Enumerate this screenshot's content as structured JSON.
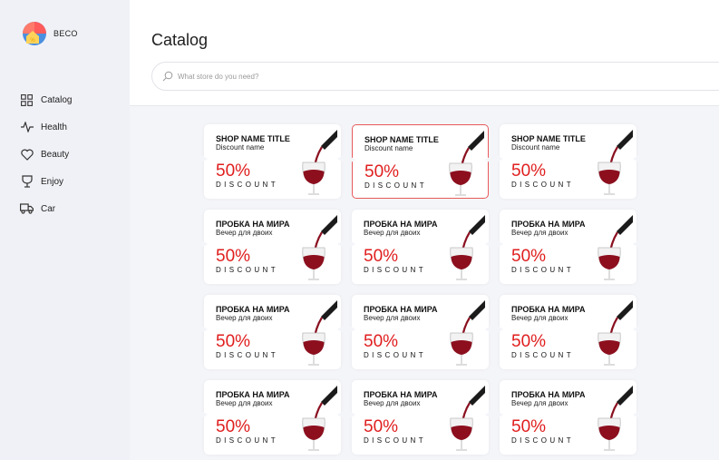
{
  "brand": {
    "name": "BECO"
  },
  "sidebar": {
    "items": [
      {
        "label": "Catalog",
        "icon": "grid-icon"
      },
      {
        "label": "Health",
        "icon": "pulse-icon"
      },
      {
        "label": "Beauty",
        "icon": "heart-icon"
      },
      {
        "label": "Enjoy",
        "icon": "goblet-icon"
      },
      {
        "label": "Car",
        "icon": "truck-icon"
      }
    ]
  },
  "header": {
    "title": "Catalog",
    "search_placeholder": "What store do you need?"
  },
  "colors": {
    "accent": "#e01e1e",
    "selected_border": "#e85a5a"
  },
  "cards": [
    {
      "shop": "SHOP NAME TITLE",
      "subtitle": "Discount name",
      "percent": "50%",
      "label": "DISCOUNT",
      "image": "wine-pour-image"
    },
    {
      "shop": "SHOP NAME TITLE",
      "subtitle": "Discount name",
      "percent": "50%",
      "label": "DISCOUNT",
      "image": "wine-pour-image"
    },
    {
      "shop": "SHOP NAME TITLE",
      "subtitle": "Discount name",
      "percent": "50%",
      "label": "DISCOUNT",
      "image": "wine-pour-image"
    },
    {
      "shop": "ПРОБКА НА МИРА",
      "subtitle": "Вечер для двоих",
      "percent": "50%",
      "label": "DISCOUNT",
      "image": "wine-pour-image"
    },
    {
      "shop": "ПРОБКА НА МИРА",
      "subtitle": "Вечер для двоих",
      "percent": "50%",
      "label": "DISCOUNT",
      "image": "wine-pour-image"
    },
    {
      "shop": "ПРОБКА НА МИРА",
      "subtitle": "Вечер для двоих",
      "percent": "50%",
      "label": "DISCOUNT",
      "image": "wine-pour-image"
    },
    {
      "shop": "ПРОБКА НА МИРА",
      "subtitle": "Вечер для двоих",
      "percent": "50%",
      "label": "DISCOUNT",
      "image": "wine-pour-image"
    },
    {
      "shop": "ПРОБКА НА МИРА",
      "subtitle": "Вечер для двоих",
      "percent": "50%",
      "label": "DISCOUNT",
      "image": "wine-pour-image"
    },
    {
      "shop": "ПРОБКА НА МИРА",
      "subtitle": "Вечер для двоих",
      "percent": "50%",
      "label": "DISCOUNT",
      "image": "wine-pour-image"
    },
    {
      "shop": "ПРОБКА НА МИРА",
      "subtitle": "Вечер для двоих",
      "percent": "50%",
      "label": "DISCOUNT",
      "image": "wine-pour-image"
    },
    {
      "shop": "ПРОБКА НА МИРА",
      "subtitle": "Вечер для двоих",
      "percent": "50%",
      "label": "DISCOUNT",
      "image": "wine-pour-image"
    },
    {
      "shop": "ПРОБКА НА МИРА",
      "subtitle": "Вечер для двоих",
      "percent": "50%",
      "label": "DISCOUNT",
      "image": "wine-pour-image"
    }
  ]
}
